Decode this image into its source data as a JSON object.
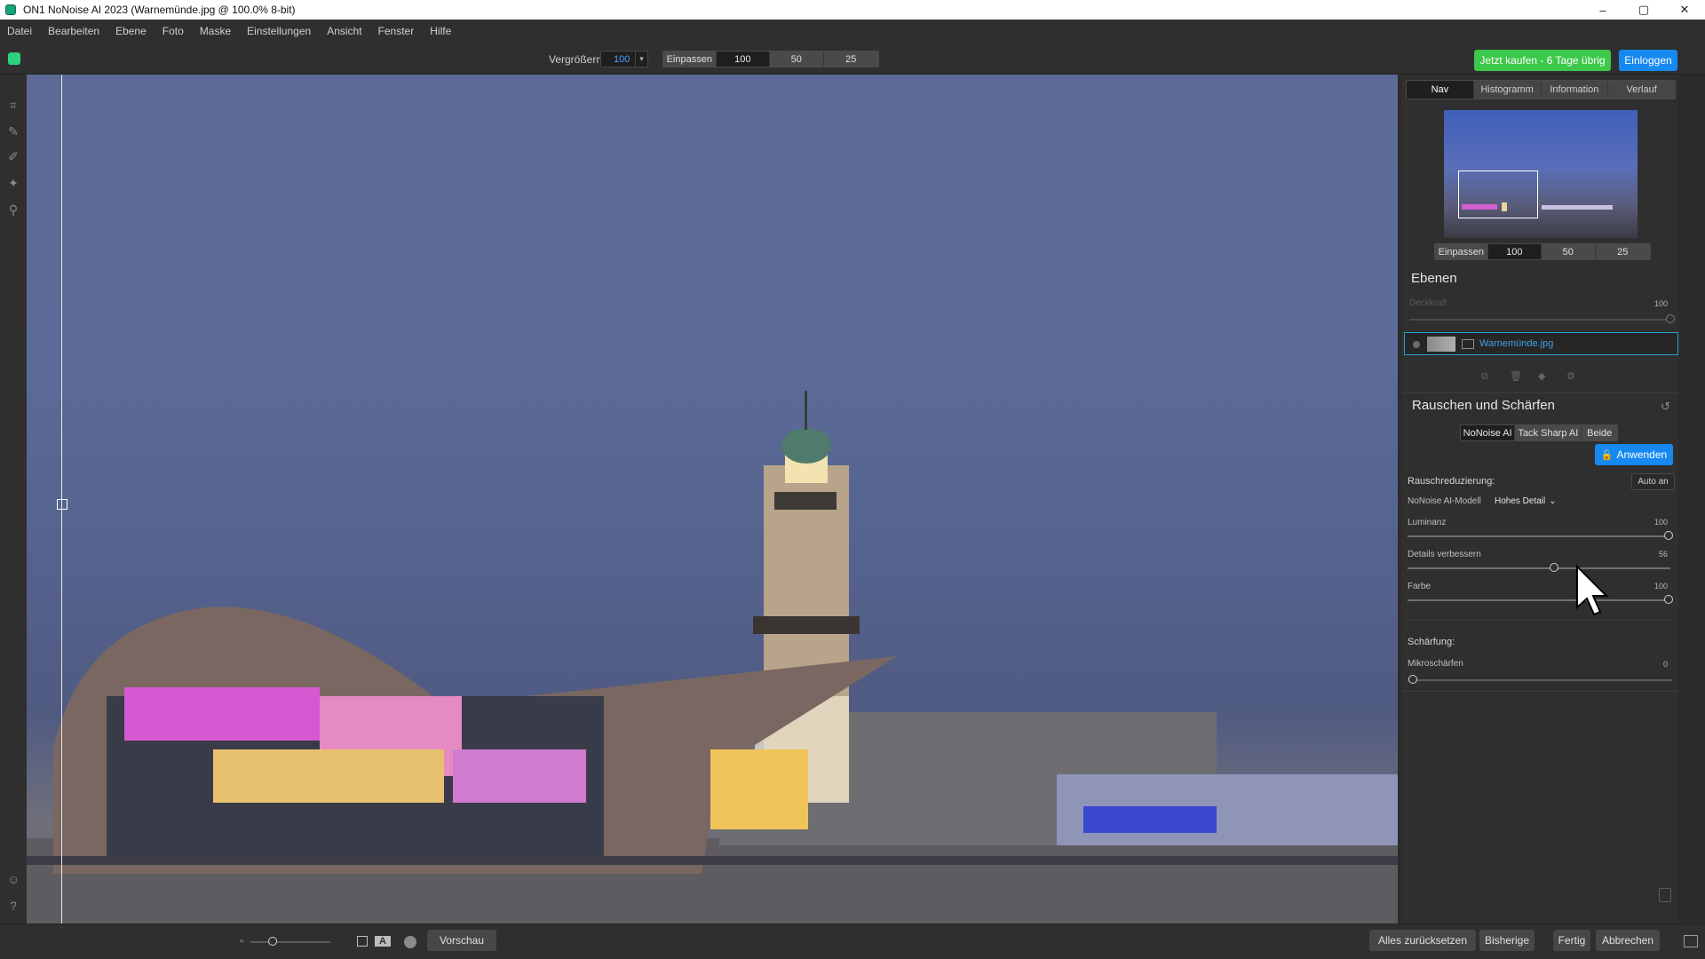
{
  "window": {
    "title": "ON1 NoNoise AI 2023 (Warnemünde.jpg @ 100.0% 8-bit)",
    "minimize": "–",
    "maximize": "▢",
    "close": "✕"
  },
  "menu": [
    "Datei",
    "Bearbeiten",
    "Ebene",
    "Foto",
    "Maske",
    "Einstellungen",
    "Ansicht",
    "Fenster",
    "Hilfe"
  ],
  "toolbar": {
    "zoom_label": "Vergrößern",
    "zoom_value": "100",
    "fit_options": [
      "Einpassen",
      "100",
      "50",
      "25"
    ],
    "buy_label": "Jetzt kaufen - 6 Tage übrig",
    "login_label": "Einloggen"
  },
  "left_tools": [
    "crop-icon",
    "brush-icon",
    "refine-brush-icon",
    "retouch-icon",
    "zoom-icon",
    "user-icon",
    "help-icon"
  ],
  "panel": {
    "tabs": [
      "Nav",
      "Histogramm",
      "Information",
      "Verlauf"
    ],
    "active_tab": "Nav",
    "nav_zoom_options": [
      "Einpassen",
      "100",
      "50",
      "25"
    ],
    "layers": {
      "title": "Ebenen",
      "opacity_label": "Deckkraft",
      "opacity_value": "100",
      "layer_name": "Warnemünde.jpg"
    },
    "noise": {
      "title": "Rauschen und Schärfen",
      "modes": [
        "NoNoise AI",
        "Tack Sharp AI",
        "Beide"
      ],
      "active_mode": "NoNoise AI",
      "apply_label": "Anwenden",
      "reduction_label": "Rauschreduzierung:",
      "auto_label": "Auto an",
      "model_label": "NoNoise AI-Modell",
      "model_value": "Hohes Detail",
      "sliders": [
        {
          "label": "Luminanz",
          "value": "100"
        },
        {
          "label": "Details verbessern",
          "value": "56"
        },
        {
          "label": "Farbe",
          "value": "100"
        }
      ],
      "sharpen_label": "Schärfung:",
      "micro_label": "Mikroschärfen",
      "micro_value": "0"
    }
  },
  "bottom": {
    "preview_label": "Vorschau",
    "reset_label": "Alles zurücksetzen",
    "previous_label": "Bisherige",
    "done_label": "Fertig",
    "cancel_label": "Abbrechen"
  }
}
